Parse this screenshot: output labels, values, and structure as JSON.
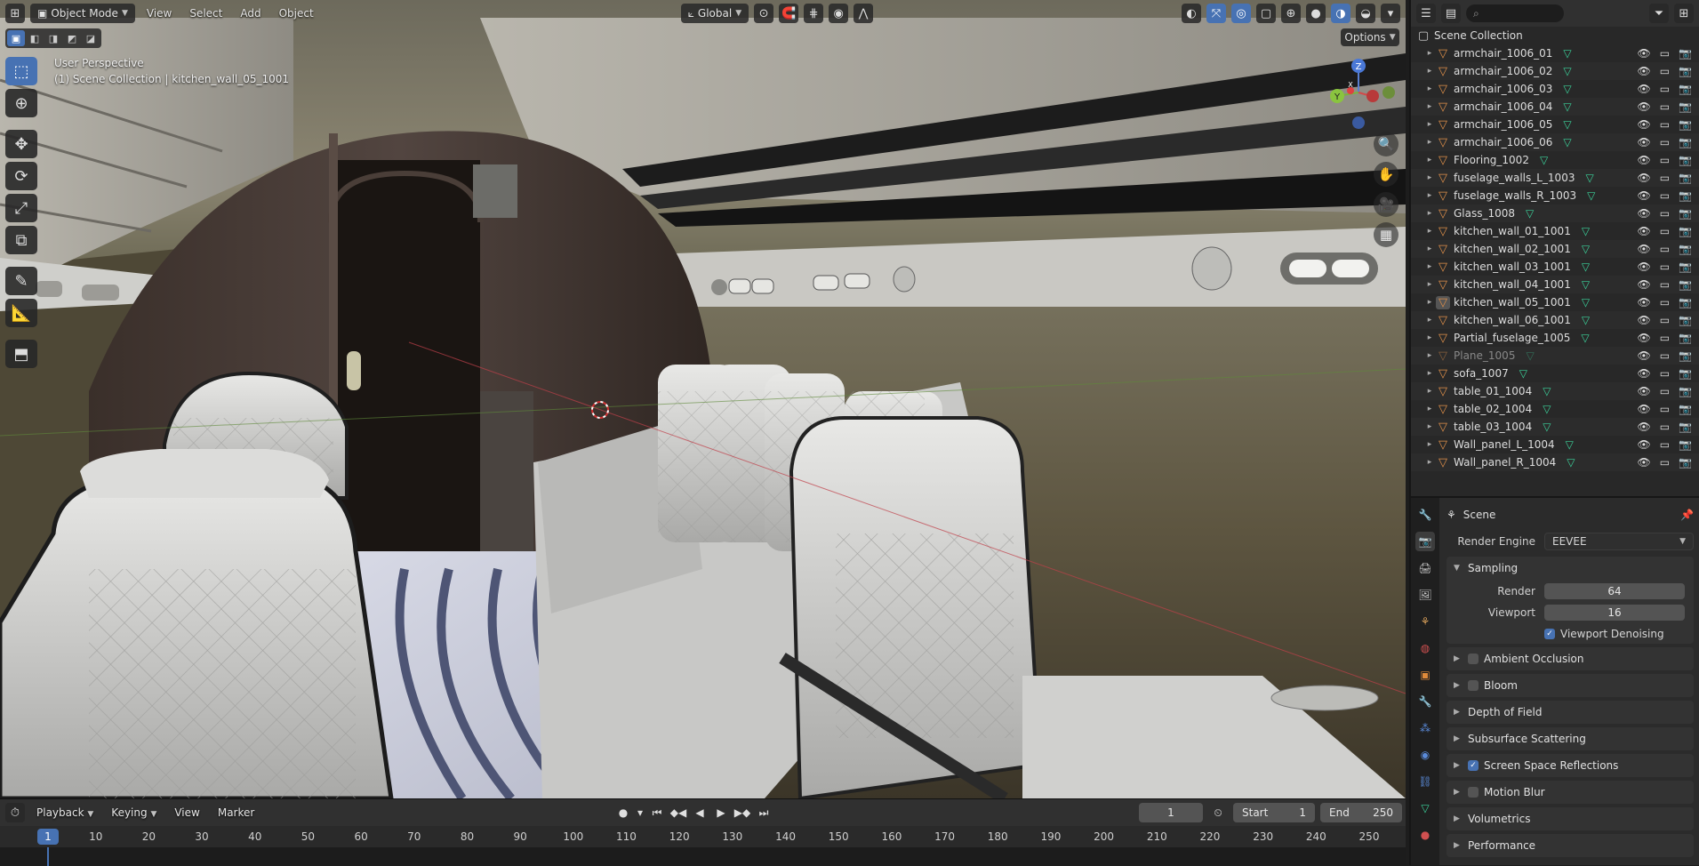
{
  "header": {
    "mode": "Object Mode",
    "menus": [
      "View",
      "Select",
      "Add",
      "Object"
    ],
    "orientation": "Global"
  },
  "viewport": {
    "view_name": "User Perspective",
    "context": "(1) Scene Collection | kitchen_wall_05_1001",
    "options_label": "Options",
    "gizmo_axes": {
      "x": "X",
      "y": "Y",
      "z": "Z"
    }
  },
  "timeline": {
    "menus": [
      "Playback",
      "Keying",
      "View",
      "Marker"
    ],
    "current_frame": "1",
    "start_label": "Start",
    "start": "1",
    "end_label": "End",
    "end": "250",
    "ruler": [
      "10",
      "20",
      "30",
      "40",
      "50",
      "60",
      "70",
      "80",
      "90",
      "100",
      "110",
      "120",
      "130",
      "140",
      "150",
      "160",
      "170",
      "180",
      "190",
      "200",
      "210",
      "220",
      "230",
      "240",
      "250"
    ],
    "playhead_frame": "1"
  },
  "outliner": {
    "root": "Scene Collection",
    "items": [
      {
        "name": "armchair_1006_01",
        "state": "normal"
      },
      {
        "name": "armchair_1006_02",
        "state": "normal"
      },
      {
        "name": "armchair_1006_03",
        "state": "normal"
      },
      {
        "name": "armchair_1006_04",
        "state": "normal"
      },
      {
        "name": "armchair_1006_05",
        "state": "normal"
      },
      {
        "name": "armchair_1006_06",
        "state": "normal"
      },
      {
        "name": "Flooring_1002",
        "state": "normal"
      },
      {
        "name": "fuselage_walls_L_1003",
        "state": "normal"
      },
      {
        "name": "fuselage_walls_R_1003",
        "state": "normal"
      },
      {
        "name": "Glass_1008",
        "state": "normal"
      },
      {
        "name": "kitchen_wall_01_1001",
        "state": "normal"
      },
      {
        "name": "kitchen_wall_02_1001",
        "state": "normal"
      },
      {
        "name": "kitchen_wall_03_1001",
        "state": "normal"
      },
      {
        "name": "kitchen_wall_04_1001",
        "state": "normal"
      },
      {
        "name": "kitchen_wall_05_1001",
        "state": "active"
      },
      {
        "name": "kitchen_wall_06_1001",
        "state": "normal"
      },
      {
        "name": "Partial_fuselage_1005",
        "state": "normal"
      },
      {
        "name": "Plane_1005",
        "state": "hidden"
      },
      {
        "name": "sofa_1007",
        "state": "normal"
      },
      {
        "name": "table_01_1004",
        "state": "normal"
      },
      {
        "name": "table_02_1004",
        "state": "normal"
      },
      {
        "name": "table_03_1004",
        "state": "normal"
      },
      {
        "name": "Wall_panel_L_1004",
        "state": "normal"
      },
      {
        "name": "Wall_panel_R_1004",
        "state": "normal"
      }
    ]
  },
  "properties": {
    "context_title": "Scene",
    "render_engine_label": "Render Engine",
    "render_engine": "EEVEE",
    "sampling": {
      "title": "Sampling",
      "render_label": "Render",
      "render": "64",
      "viewport_label": "Viewport",
      "viewport": "16",
      "denoise_label": "Viewport Denoising"
    },
    "panels": [
      {
        "label": "Ambient Occlusion",
        "checkbox": "off"
      },
      {
        "label": "Bloom",
        "checkbox": "off"
      },
      {
        "label": "Depth of Field",
        "checkbox": "none"
      },
      {
        "label": "Subsurface Scattering",
        "checkbox": "none"
      },
      {
        "label": "Screen Space Reflections",
        "checkbox": "on"
      },
      {
        "label": "Motion Blur",
        "checkbox": "off"
      },
      {
        "label": "Volumetrics",
        "checkbox": "none"
      },
      {
        "label": "Performance",
        "checkbox": "none"
      }
    ]
  },
  "colors": {
    "accent": "#4772b3",
    "object_icon": "#e0904a",
    "mesh_icon": "#3bd19a"
  }
}
